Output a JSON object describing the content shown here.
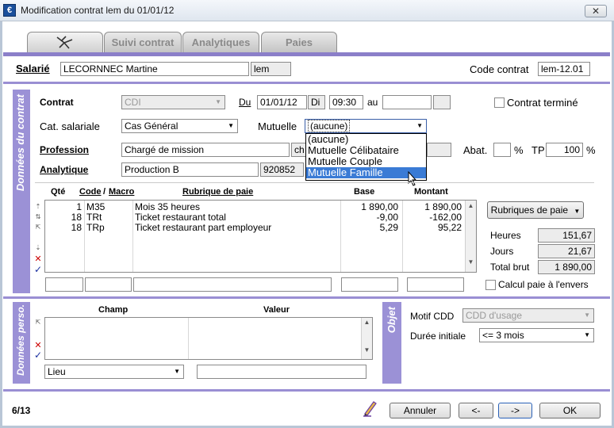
{
  "window": {
    "title": "Modification contrat lem du 01/01/12",
    "app_icon": "€",
    "close_glyph": "✕"
  },
  "tabs": [
    {
      "label": "",
      "icon": "plane-icon"
    },
    {
      "label": "Suivi contrat"
    },
    {
      "label": "Analytiques"
    },
    {
      "label": "Paies"
    }
  ],
  "header": {
    "salarie_label": "Salarié",
    "salarie_name": "LECORNNEC Martine",
    "salarie_code": "lem",
    "code_contrat_label": "Code contrat",
    "code_contrat_value": "lem-12.01"
  },
  "contrat": {
    "side_title": "Données du contrat",
    "contrat_label": "Contrat",
    "contrat_value": "CDI",
    "du_label": "Du",
    "du_date": "01/01/12",
    "du_day": "Di",
    "du_time": "09:30",
    "au_label": "au",
    "au_date": "",
    "au_extra": "",
    "termine_label": "Contrat terminé",
    "cat_label": "Cat. salariale",
    "cat_value": "Cas Général",
    "mutuelle_label": "Mutuelle",
    "mutuelle_value": "(aucune)",
    "mutuelle_options": [
      "(aucune)",
      "Mutuelle Célibataire",
      "Mutuelle Couple",
      "Mutuelle Famille"
    ],
    "mutuelle_highlight": "Mutuelle Famille",
    "profession_label": "Profession",
    "profession_value": "Chargé de mission",
    "profession_code": "ch",
    "abat_label": "Abat.",
    "abat_value": "",
    "pct": "%",
    "tp_label": "TP",
    "tp_value": "100",
    "analytique_label": "Analytique",
    "analytique_value": "Production B",
    "analytique_code": "920852"
  },
  "rubriques": {
    "headers": {
      "qte": "Qté",
      "code": "Code",
      "slash": "/",
      "macro": "Macro",
      "rubrique": "Rubrique de paie",
      "base": "Base",
      "montant": "Montant"
    },
    "rows": [
      {
        "qte": "1",
        "code": "M35",
        "rubrique": "Mois 35 heures",
        "base": "1 890,00",
        "montant": "1 890,00"
      },
      {
        "qte": "18",
        "code": "TRt",
        "rubrique": "Ticket restaurant total",
        "base": "-9,00",
        "montant": "-162,00"
      },
      {
        "qte": "18",
        "code": "TRp",
        "rubrique": "Ticket restaurant part employeur",
        "base": "5,29",
        "montant": "95,22"
      }
    ],
    "rubriques_button": "Rubriques de paie",
    "heures_label": "Heures",
    "heures_value": "151,67",
    "jours_label": "Jours",
    "jours_value": "21,67",
    "total_label": "Total brut",
    "total_value": "1 890,00",
    "calcul_label": "Calcul paie à l'envers"
  },
  "perso": {
    "side_title": "Données perso.",
    "champ_header": "Champ",
    "valeur_header": "Valeur",
    "lieu_value": "Lieu",
    "lieu_input": ""
  },
  "objet": {
    "side_title": "Objet",
    "motif_label": "Motif CDD",
    "motif_value": "CDD d'usage",
    "duree_label": "Durée initiale",
    "duree_value": "<= 3 mois"
  },
  "footer": {
    "counter": "6/13",
    "annuler": "Annuler",
    "prev": "<-",
    "next": "->",
    "ok": "OK"
  },
  "colors": {
    "accent_purple": "#9b91d6",
    "selection_blue": "#3a7bd5"
  }
}
